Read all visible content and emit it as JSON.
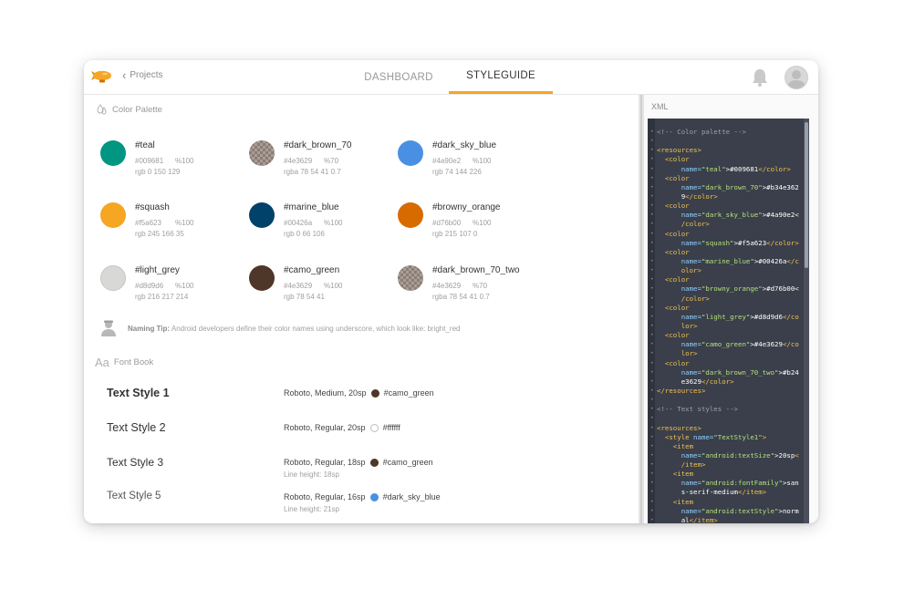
{
  "nav": {
    "back_label": "Projects",
    "tabs": [
      {
        "label": "DASHBOARD",
        "active": false
      },
      {
        "label": "STYLEGUIDE",
        "active": true
      }
    ],
    "accent": "#f5a623"
  },
  "palette": {
    "heading": "Color Palette",
    "colors": [
      {
        "name": "#teal",
        "hex": "#009681",
        "alpha": "%100",
        "rgb": "rgb 0 150 129",
        "color": "#009681"
      },
      {
        "name": "#dark_brown_70",
        "hex": "#4e3629",
        "alpha": "%70",
        "rgb": "rgba 78 54 41 0.7",
        "color": "#4e3629"
      },
      {
        "name": "#dark_sky_blue",
        "hex": "#4a90e2",
        "alpha": "%100",
        "rgb": "rgb 74 144 226",
        "color": "#4a90e2"
      },
      {
        "name": "#squash",
        "hex": "#f5a623",
        "alpha": "%100",
        "rgb": "rgb 245 166 35",
        "color": "#f5a623"
      },
      {
        "name": "#marine_blue",
        "hex": "#00426a",
        "alpha": "%100",
        "rgb": "rgb 0 66 106",
        "color": "#00426a"
      },
      {
        "name": "#browny_orange",
        "hex": "#d76b00",
        "alpha": "%100",
        "rgb": "rgb 215 107 0",
        "color": "#d76b00"
      },
      {
        "name": "#light_grey",
        "hex": "#d8d9d6",
        "alpha": "%100",
        "rgb": "rgb 216 217 214",
        "color": "#d8d9d6"
      },
      {
        "name": "#camo_green",
        "hex": "#4e3629",
        "alpha": "%100",
        "rgb": "rgb 78 54 41",
        "color": "#4e3629"
      },
      {
        "name": "#dark_brown_70_two",
        "hex": "#4e3629",
        "alpha": "%70",
        "rgb": "rgba 78 54 41 0.7",
        "color": "#4e3629"
      }
    ],
    "tip_bold": "Naming Tip:",
    "tip_text": " Android developers define their color names using underscore, which look like: bright_red"
  },
  "fontbook": {
    "heading": "Font Book",
    "heading_glyph": "Aa",
    "styles": [
      {
        "label": "Text Style 1",
        "spec": "Roboto, Medium, 20sp",
        "color_name": "#camo_green",
        "color": "#4e3629",
        "line_height": ""
      },
      {
        "label": "Text Style 2",
        "spec": "Roboto, Regular, 20sp",
        "color_name": "#ffffff",
        "color": "#ffffff",
        "line_height": ""
      },
      {
        "label": "Text Style 3",
        "spec": "Roboto, Regular, 18sp",
        "color_name": "#camo_green",
        "color": "#4e3629",
        "line_height": "Line height: 18sp"
      },
      {
        "label": "Text Style 5",
        "spec": "Roboto, Regular, 16sp",
        "color_name": "#dark_sky_blue",
        "color": "#4a90e2",
        "line_height": "Line height: 21sp"
      }
    ]
  },
  "xml_panel": {
    "title": "XML",
    "lines": [
      [
        [
          "c-cm",
          "<!-- Color palette -->"
        ]
      ],
      [
        [
          "c-txt",
          ""
        ]
      ],
      [
        [
          "c-tag",
          "<resources>"
        ]
      ],
      [
        [
          "c-tag",
          "  <color"
        ]
      ],
      [
        [
          "c-att",
          "      name="
        ],
        [
          "c-val",
          "\"teal\""
        ],
        [
          "c-txt",
          ">#009681"
        ],
        [
          "c-tag",
          "</color>"
        ]
      ],
      [
        [
          "c-tag",
          "  <color"
        ]
      ],
      [
        [
          "c-att",
          "      name="
        ],
        [
          "c-val",
          "\"dark_brown_70\""
        ],
        [
          "c-txt",
          ">#b34e362"
        ]
      ],
      [
        [
          "c-txt",
          "      9"
        ],
        [
          "c-tag",
          "</color>"
        ]
      ],
      [
        [
          "c-tag",
          "  <color"
        ]
      ],
      [
        [
          "c-att",
          "      name="
        ],
        [
          "c-val",
          "\"dark_sky_blue\""
        ],
        [
          "c-txt",
          ">#4a90e2<"
        ]
      ],
      [
        [
          "c-tag",
          "      /color>"
        ]
      ],
      [
        [
          "c-tag",
          "  <color"
        ]
      ],
      [
        [
          "c-att",
          "      name="
        ],
        [
          "c-val",
          "\"squash\""
        ],
        [
          "c-txt",
          ">#f5a623"
        ],
        [
          "c-tag",
          "</color>"
        ]
      ],
      [
        [
          "c-tag",
          "  <color"
        ]
      ],
      [
        [
          "c-att",
          "      name="
        ],
        [
          "c-val",
          "\"marine_blue\""
        ],
        [
          "c-txt",
          ">#00426a"
        ],
        [
          "c-tag",
          "</c"
        ]
      ],
      [
        [
          "c-tag",
          "      olor>"
        ]
      ],
      [
        [
          "c-tag",
          "  <color"
        ]
      ],
      [
        [
          "c-att",
          "      name="
        ],
        [
          "c-val",
          "\"browny_orange\""
        ],
        [
          "c-txt",
          ">#d76b00<"
        ]
      ],
      [
        [
          "c-tag",
          "      /color>"
        ]
      ],
      [
        [
          "c-tag",
          "  <color"
        ]
      ],
      [
        [
          "c-att",
          "      name="
        ],
        [
          "c-val",
          "\"light_grey\""
        ],
        [
          "c-txt",
          ">#d8d9d6"
        ],
        [
          "c-tag",
          "</co"
        ]
      ],
      [
        [
          "c-tag",
          "      lor>"
        ]
      ],
      [
        [
          "c-tag",
          "  <color"
        ]
      ],
      [
        [
          "c-att",
          "      name="
        ],
        [
          "c-val",
          "\"camo_green\""
        ],
        [
          "c-txt",
          ">#4e3629"
        ],
        [
          "c-tag",
          "</co"
        ]
      ],
      [
        [
          "c-tag",
          "      lor>"
        ]
      ],
      [
        [
          "c-tag",
          "  <color"
        ]
      ],
      [
        [
          "c-att",
          "      name="
        ],
        [
          "c-val",
          "\"dark_brown_70_two\""
        ],
        [
          "c-txt",
          ">#b24"
        ]
      ],
      [
        [
          "c-txt",
          "      e3629"
        ],
        [
          "c-tag",
          "</color>"
        ]
      ],
      [
        [
          "c-tag",
          "</resources>"
        ]
      ],
      [
        [
          "c-txt",
          ""
        ]
      ],
      [
        [
          "c-cm",
          "<!-- Text styles -->"
        ]
      ],
      [
        [
          "c-txt",
          ""
        ]
      ],
      [
        [
          "c-tag",
          "<resources>"
        ]
      ],
      [
        [
          "c-tag",
          "  <style "
        ],
        [
          "c-att",
          "name="
        ],
        [
          "c-val",
          "\"TextStyle1\""
        ],
        [
          "c-tag",
          ">"
        ]
      ],
      [
        [
          "c-tag",
          "    <item"
        ]
      ],
      [
        [
          "c-att",
          "      name="
        ],
        [
          "c-val",
          "\"android:textSize\""
        ],
        [
          "c-txt",
          ">20sp"
        ],
        [
          "c-tag",
          "<"
        ]
      ],
      [
        [
          "c-tag",
          "      /item>"
        ]
      ],
      [
        [
          "c-tag",
          "    <item"
        ]
      ],
      [
        [
          "c-att",
          "      name="
        ],
        [
          "c-val",
          "\"android:fontFamily\""
        ],
        [
          "c-txt",
          ">san"
        ]
      ],
      [
        [
          "c-txt",
          "      s-serif-medium"
        ],
        [
          "c-tag",
          "</item>"
        ]
      ],
      [
        [
          "c-tag",
          "    <item"
        ]
      ],
      [
        [
          "c-att",
          "      name="
        ],
        [
          "c-val",
          "\"android:textStyle\""
        ],
        [
          "c-txt",
          ">norm"
        ]
      ],
      [
        [
          "c-txt",
          "      al"
        ],
        [
          "c-tag",
          "</item>"
        ]
      ]
    ]
  }
}
